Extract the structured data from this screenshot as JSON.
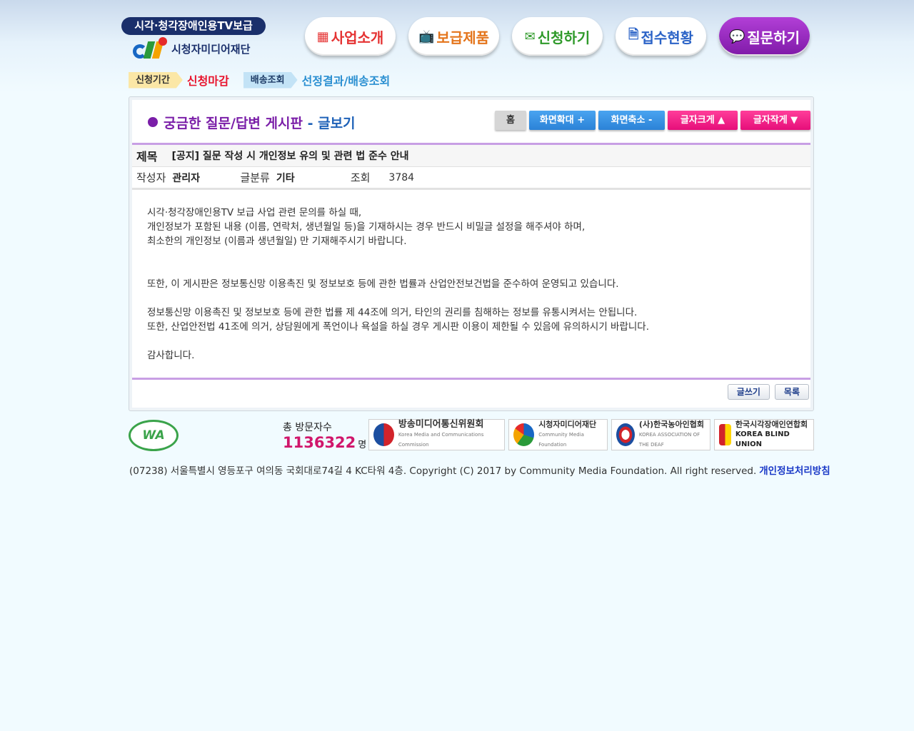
{
  "header": {
    "logo_tagline": "시각·청각장애인용TV보급",
    "logo_name": "시청자미디어재단",
    "nav": [
      {
        "label": "사업소개",
        "icon": "building-icon",
        "color": "#e53333"
      },
      {
        "label": "보급제품",
        "icon": "tv-icon",
        "color": "#e4751c"
      },
      {
        "label": "신청하기",
        "icon": "mail-icon",
        "color": "#2f9a2a"
      },
      {
        "label": "접수현황",
        "icon": "document-icon",
        "color": "#2b63c7"
      },
      {
        "label": "질문하기",
        "icon": "chat-bubble-icon",
        "color": "#8e2bbd",
        "active": true
      }
    ]
  },
  "status": {
    "period_label": "신청기간",
    "period_value": "신청마감",
    "delivery_label": "배송조회",
    "delivery_value": "선정결과/배송조회"
  },
  "board": {
    "title_prefix": "궁금한 질문/답변 게시판",
    "title_suffix": " - 글보기",
    "tools": {
      "home": "홈",
      "zoom_in": "화면확대 +",
      "zoom_out": "화면축소 -",
      "font_bigger": "글자크게 ▲",
      "font_smaller": "글자작게 ▼"
    },
    "subject_label": "제목",
    "subject": "[공지] 질문 작성 시 개인정보 유의 및 관련 법 준수 안내",
    "author_label": "작성자",
    "author": "관리자",
    "category_label": "글분류",
    "category": "기타",
    "views_label": "조회",
    "views": "3784",
    "content_lines": [
      "시각·청각장애인용TV 보급 사업 관련 문의를 하실 때,",
      "개인정보가 포함된 내용 (이름, 연락처, 생년월일 등)을 기재하시는 경우 반드시 비밀글 설정을 해주셔야 하며,",
      "최소한의 개인정보 (이름과 생년월일) 만 기재해주시기 바랍니다.",
      "",
      "",
      "또한, 이 게시판은 정보통신망 이용촉진 및 정보보호 등에 관한 법률과 산업안전보건법을 준수하여 운영되고 있습니다.",
      "",
      "정보통신망 이용촉진 및 정보보호 등에 관한 법률 제 44조에 의거, 타인의 권리를 침해하는 정보를 유통시켜서는 안됩니다.",
      "또한, 산업안전법 41조에 의거, 상담원에게 폭언이나 욕설을 하실 경우 게시판 이용이 제한될 수 있음에 유의하시기 바랍니다.",
      "",
      "감사합니다."
    ],
    "write_button": "글쓰기",
    "list_button": "목록"
  },
  "footer": {
    "wa_mark": "WA",
    "visitors_label": "총 방문자수",
    "visitors_count": "1136322",
    "visitors_unit": "명",
    "partners": [
      {
        "name": "방송미디어통신위원회",
        "sub": "Korea Media and Communications Commission"
      },
      {
        "name": "시청자미디어재단",
        "sub": "Community Media Foundation"
      },
      {
        "name": "(사)한국농아인협회",
        "sub": "KOREA ASSOCIATION OF THE DEAF"
      },
      {
        "name": "한국시각장애인연합회",
        "sub": "KOREA BLIND UNION"
      }
    ],
    "address": "(07238) 서울특별시 영등포구 여의동 국회대로74길 4 KC타워 4층. Copyright (C) 2017 by Community Media Foundation. All right reserved.",
    "privacy": "개인정보처리방침"
  }
}
